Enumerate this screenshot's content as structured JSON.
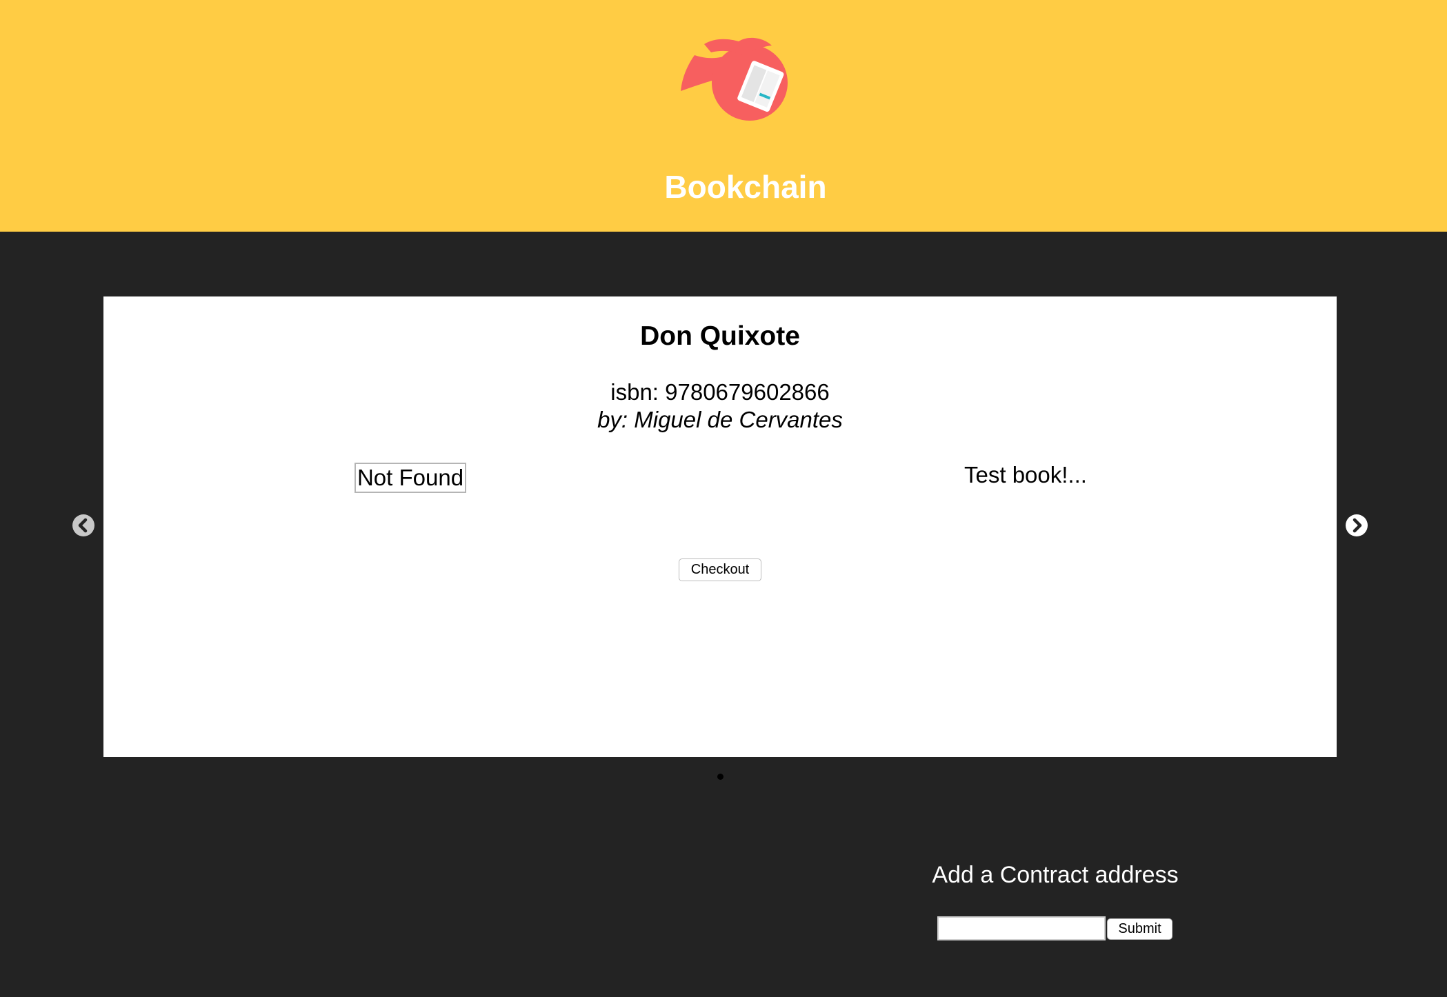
{
  "header": {
    "site_title": "Bookchain",
    "logo_icon": "person-reading-book-icon",
    "background_color": "#ffcc44"
  },
  "carousel": {
    "book": {
      "title": "Don Quixote",
      "isbn_text": "isbn: 9780679602866",
      "author_text": "by: Miguel de Cervantes",
      "cover_image_alt": "Not Found",
      "description": "Test book!..."
    },
    "checkout_label": "Checkout",
    "prev_icon": "chevron-left-circle-icon",
    "next_icon": "chevron-right-circle-icon",
    "slide_count": 1,
    "active_slide": 1
  },
  "contract_form": {
    "heading": "Add a Contract address",
    "input_value": "",
    "submit_label": "Submit"
  },
  "colors": {
    "page_background": "#232323",
    "card_background": "#ffffff",
    "logo_accent": "#f75f5f"
  }
}
